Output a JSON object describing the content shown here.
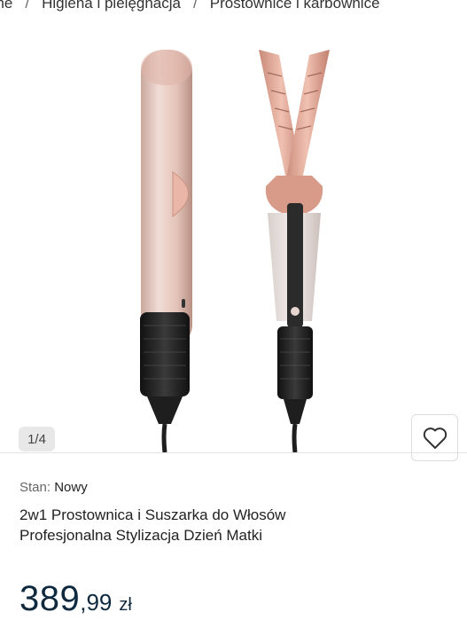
{
  "breadcrumb": {
    "items": [
      "one",
      "Higiena i pielęgnacja",
      "Prostownice i karbownice"
    ],
    "separator": "/"
  },
  "gallery": {
    "counter": "1/4",
    "favorite_icon": "heart-icon"
  },
  "product": {
    "condition_label": "Stan:",
    "condition_value": "Nowy",
    "title_line1": "2w1 Prostownica i Suszarka do Włosów",
    "title_line2": "Profesjonalna Stylizacja Dzień Matki",
    "price_int": "389",
    "price_dec": ",99",
    "currency": "zł"
  },
  "colors": {
    "price": "#0f2a3f",
    "rose_gold": "#e5b7a9",
    "grip": "#1c1c1c"
  }
}
